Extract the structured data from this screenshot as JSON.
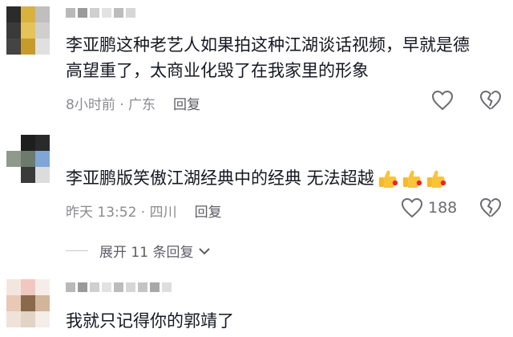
{
  "comments": [
    {
      "text_line1": "李亚鹏这种老艺人如果拍这种江湖谈话视频，早就是德",
      "text_line2": "高望重了，太商业化毁了在我家里的形象",
      "time_location": "8小时前 · 广东",
      "reply_label": "回复",
      "likes": ""
    },
    {
      "text": "李亚鹏版笑傲江湖经典中的经典 无法超越",
      "emoji": "thumbs-up-icon ×3",
      "time_location": "昨天 13:52 · 四川",
      "reply_label": "回复",
      "likes": "188"
    },
    {
      "text": "我就只记得你的郭靖了"
    }
  ],
  "expand_replies_label": "展开 11 条回复",
  "colors": {
    "text": "#161823",
    "meta": "#8a8b91",
    "icon": "#6b6c72"
  }
}
